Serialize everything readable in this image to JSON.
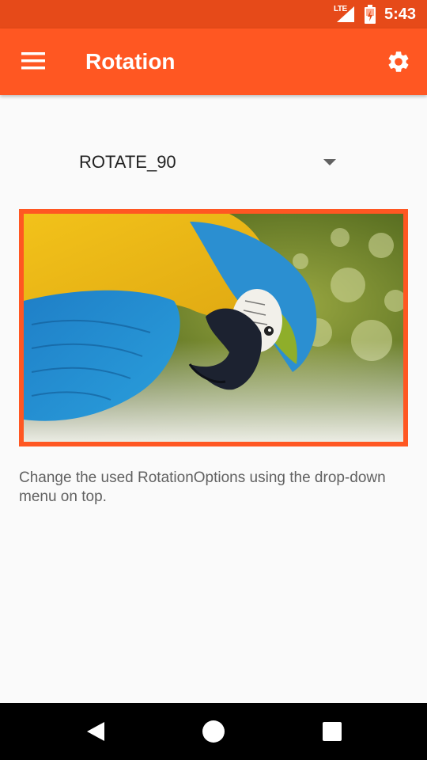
{
  "status_bar": {
    "network": "LTE",
    "time": "5:43",
    "icons": [
      "signal-icon",
      "battery-charging-icon"
    ]
  },
  "app_bar": {
    "title": "Rotation",
    "menu_icon": "menu-icon",
    "settings_icon": "gear-icon"
  },
  "spinner": {
    "selected": "ROTATE_90"
  },
  "image": {
    "subject": "macaw-parrot-photo"
  },
  "description": "Change the used RotationOptions using the drop-down menu on top.",
  "nav_bar": {
    "icons": [
      "back-icon",
      "home-icon",
      "recents-icon"
    ]
  },
  "colors": {
    "status_bar": "#e64a19",
    "app_bar": "#ff5722",
    "frame": "#ff5722",
    "background": "#fafafa"
  }
}
